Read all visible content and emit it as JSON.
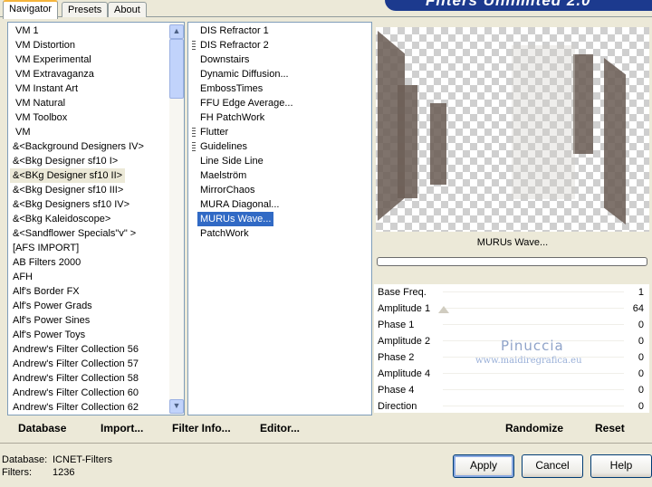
{
  "header": {
    "tabs": [
      "Navigator",
      "Presets",
      "About"
    ],
    "banner": "Filters Unlimited 2.0"
  },
  "categories": {
    "items": [
      "VM 1",
      "VM Distortion",
      "VM Experimental",
      "VM Extravaganza",
      "VM Instant Art",
      "VM Natural",
      "VM Toolbox",
      "VM",
      "&<Background Designers IV>",
      "&<Bkg Designer sf10 I>",
      "&<BKg Designer sf10 II>",
      "&<Bkg Designer sf10 III>",
      "&<Bkg Designers sf10 IV>",
      "&<Bkg Kaleidoscope>",
      "&<Sandflower Specials\"v\" >",
      "[AFS IMPORT]",
      "AB Filters 2000",
      "AFH",
      "Alf's Border FX",
      "Alf's Power Grads",
      "Alf's Power Sines",
      "Alf's Power Toys",
      "Andrew's Filter Collection 56",
      "Andrew's Filter Collection 57",
      "Andrew's Filter Collection 58",
      "Andrew's Filter Collection 60",
      "Andrew's Filter Collection 62"
    ],
    "selected": "&<BKg Designer sf10 II>"
  },
  "filters": {
    "items": [
      "DIS Refractor 1",
      "DIS Refractor 2",
      "Downstairs",
      "Dynamic Diffusion...",
      "EmbossTimes",
      "FFU Edge Average...",
      "FH PatchWork",
      "Flutter",
      "Guidelines",
      "Line Side Line",
      "Maelström",
      "MirrorChaos",
      "MURA Diagonal...",
      "MURUs Wave...",
      "PatchWork"
    ],
    "selected": "MURUs Wave..."
  },
  "preview": {
    "filter_name": "MURUs Wave..."
  },
  "params": [
    {
      "label": "Base Freq.",
      "value": "1"
    },
    {
      "label": "Amplitude 1",
      "value": "64"
    },
    {
      "label": "Phase 1",
      "value": "0"
    },
    {
      "label": "Amplitude 2",
      "value": "0"
    },
    {
      "label": "Phase 2",
      "value": "0"
    },
    {
      "label": "Amplitude 4",
      "value": "0"
    },
    {
      "label": "Phase 4",
      "value": "0"
    },
    {
      "label": "Direction",
      "value": "0"
    }
  ],
  "watermark": {
    "name": "Pinuccia",
    "url": "www.maidiregrafica.eu"
  },
  "toolbar": {
    "database": "Database",
    "import": "Import...",
    "filter_info": "Filter Info...",
    "editor": "Editor...",
    "randomize": "Randomize",
    "reset": "Reset"
  },
  "status": {
    "database_label": "Database:",
    "database_value": "ICNET-Filters",
    "filters_label": "Filters:",
    "filters_value": "1236"
  },
  "buttons": {
    "apply": "Apply",
    "cancel": "Cancel",
    "help": "Help"
  },
  "colors": {
    "selection": "#316ac5",
    "banner": "#1c3a8e",
    "tab_accent": "#f5b43b"
  }
}
